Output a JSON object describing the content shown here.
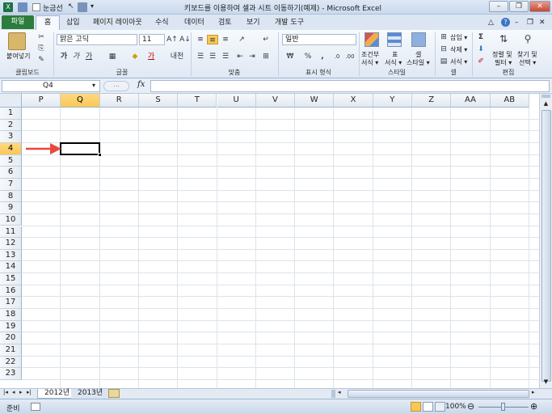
{
  "window": {
    "title": "키보드를 이용하여 셀과 시트 이동하기(예제) - Microsoft Excel",
    "quick_access_label": "눈금선"
  },
  "tabs": {
    "file": "파일",
    "items": [
      "홈",
      "삽입",
      "페이지 레이아웃",
      "수식",
      "데이터",
      "검토",
      "보기",
      "개발 도구"
    ]
  },
  "ribbon": {
    "clipboard": {
      "paste": "붙여넣기",
      "label": "클립보드"
    },
    "font": {
      "name": "맑은 고딕",
      "size": "11",
      "label": "글꼴",
      "bold": "가",
      "italic": "가",
      "underline": "가",
      "fontcolor": "가",
      "phonetic": "내천"
    },
    "align": {
      "label": "맞춤"
    },
    "number": {
      "format": "일반",
      "label": "표시 형식",
      "percent": "%",
      "comma": ","
    },
    "styles": {
      "label": "스타일",
      "cond1": "조건부",
      "cond2": "서식 ▾",
      "table1": "표",
      "table2": "서식 ▾",
      "cell1": "셀",
      "cell2": "스타일 ▾"
    },
    "cells": {
      "label": "셀",
      "insert": "삽입 ▾",
      "delete": "삭제 ▾",
      "format": "서식 ▾"
    },
    "editing": {
      "label": "편집",
      "sort1": "정렬 및",
      "sort2": "필터 ▾",
      "find1": "찾기 및",
      "find2": "선택 ▾"
    }
  },
  "formula": {
    "namebox": "Q4",
    "fx": "fx",
    "content": ""
  },
  "columns": [
    "P",
    "Q",
    "R",
    "S",
    "T",
    "U",
    "V",
    "W",
    "X",
    "Y",
    "Z",
    "AA",
    "AB"
  ],
  "rows": [
    "1",
    "2",
    "3",
    "4",
    "5",
    "6",
    "7",
    "8",
    "9",
    "10",
    "11",
    "12",
    "13",
    "14",
    "15",
    "16",
    "17",
    "18",
    "19",
    "20",
    "21",
    "22",
    "23"
  ],
  "selected": {
    "column": "Q",
    "row": "4"
  },
  "sheets": [
    "2012년",
    "2013년"
  ],
  "status": {
    "ready": "준비",
    "zoom": "100%"
  },
  "colors": {
    "accent_arrow": "#e8493d",
    "file_tab": "#2a7d3a",
    "header_selected": "#f9c755"
  }
}
